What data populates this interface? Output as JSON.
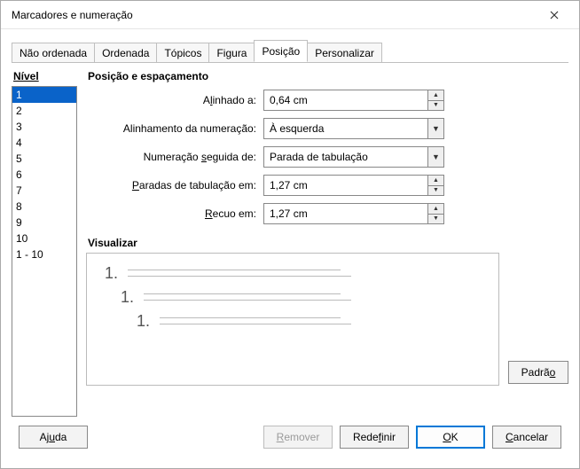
{
  "window": {
    "title": "Marcadores e numeração"
  },
  "tabs": {
    "items": [
      {
        "label": "Não ordenada"
      },
      {
        "label": "Ordenada"
      },
      {
        "label": "Tópicos"
      },
      {
        "label": "Figura"
      },
      {
        "label": "Posição"
      },
      {
        "label": "Personalizar"
      }
    ],
    "active_index": 4
  },
  "level": {
    "heading": "Nível",
    "items": [
      "1",
      "2",
      "3",
      "4",
      "5",
      "6",
      "7",
      "8",
      "9",
      "10",
      "1 - 10"
    ],
    "selected_index": 0
  },
  "section_title": "Posição e espaçamento",
  "fields": {
    "aligned_to": {
      "label_pre": "A",
      "label_ul": "l",
      "label_post": "inhado a:",
      "value": "0,64 cm",
      "type": "spin"
    },
    "num_align": {
      "label_pre": "Alinhamento da numeração:",
      "label_ul": "",
      "label_post": "",
      "value": "À esquerda",
      "type": "combo"
    },
    "followed_by": {
      "label_pre": "Numeração ",
      "label_ul": "s",
      "label_post": "eguida de:",
      "value": "Parada de tabulação",
      "type": "combo"
    },
    "tab_stop": {
      "label_pre": "",
      "label_ul": "P",
      "label_post": "aradas de tabulação em:",
      "value": "1,27 cm",
      "type": "spin"
    },
    "indent": {
      "label_pre": "",
      "label_ul": "R",
      "label_post": "ecuo em:",
      "value": "1,27 cm",
      "type": "spin"
    }
  },
  "preview": {
    "heading": "Visualizar",
    "numeral": "1."
  },
  "buttons": {
    "default": {
      "pre": "Padrã",
      "ul": "o",
      "post": ""
    },
    "help": {
      "pre": "Aj",
      "ul": "u",
      "post": "da"
    },
    "remove": {
      "pre": "",
      "ul": "R",
      "post": "emover"
    },
    "reset": {
      "pre": "Rede",
      "ul": "f",
      "post": "inir"
    },
    "ok": {
      "pre": "",
      "ul": "O",
      "post": "K"
    },
    "cancel": {
      "pre": "",
      "ul": "C",
      "post": "ancelar"
    }
  }
}
